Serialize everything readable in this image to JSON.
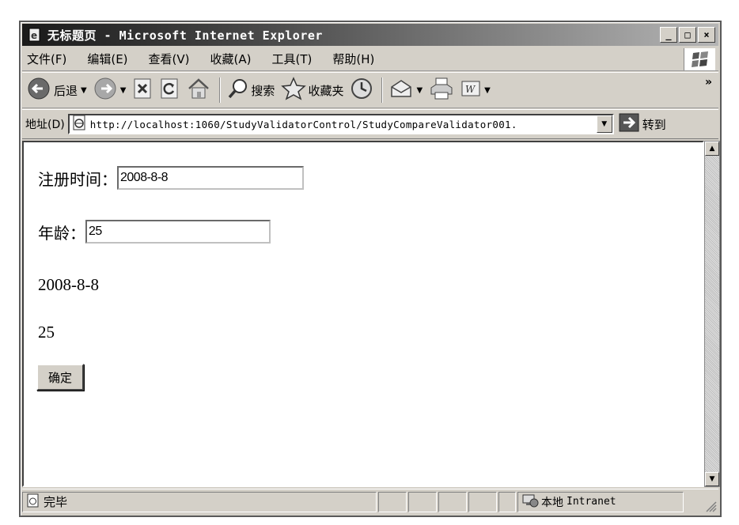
{
  "window": {
    "title": "无标题页 - Microsoft Internet Explorer",
    "minimize_label": "_",
    "maximize_label": "□",
    "close_label": "×"
  },
  "menubar": {
    "items": [
      "文件(F)",
      "编辑(E)",
      "查看(V)",
      "收藏(A)",
      "工具(T)",
      "帮助(H)"
    ]
  },
  "toolbar": {
    "back_label": "后退",
    "search_label": "搜索",
    "favorites_label": "收藏夹",
    "more_label": "»"
  },
  "address": {
    "label": "地址(D)",
    "url": "http://localhost:1060/StudyValidatorControl/StudyCompareValidator001.",
    "go_label": "转到"
  },
  "form": {
    "reg_time_label": "注册时间：",
    "reg_time_value": "2008-8-8",
    "age_label": "年龄：",
    "age_value": "25",
    "output_date": "2008-8-8",
    "output_age": "25",
    "submit_label": "确定"
  },
  "status": {
    "text": "完毕",
    "zone_cn": "本地",
    "zone_en": "Intranet"
  },
  "icons": [
    "ie-page-icon",
    "back-icon",
    "forward-icon",
    "stop-icon",
    "refresh-icon",
    "home-icon",
    "search-icon",
    "favorites-icon",
    "history-icon",
    "mail-icon",
    "print-icon",
    "edit-icon",
    "go-arrow-icon",
    "windows-logo-icon",
    "intranet-icon"
  ]
}
